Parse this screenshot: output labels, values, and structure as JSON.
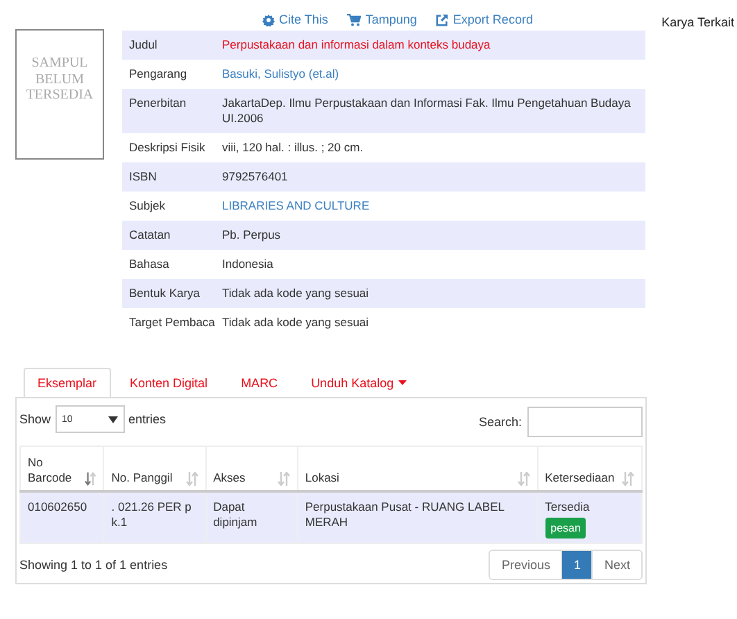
{
  "cover": {
    "text": "SAMPUL BELUM TERSEDIA"
  },
  "actions": [
    {
      "label": "Cite This"
    },
    {
      "label": "Tampung"
    },
    {
      "label": "Export Record"
    }
  ],
  "related": {
    "title": "Karya Terkait"
  },
  "details": [
    {
      "label": "Judul",
      "value": "Perpustakaan dan informasi dalam konteks budaya",
      "kind": "title"
    },
    {
      "label": "Pengarang",
      "value": "Basuki, Sulistyo (et.al)",
      "kind": "link"
    },
    {
      "label": "Penerbitan",
      "value": "JakartaDep. Ilmu Perpustakaan dan Informasi Fak. Ilmu Pengetahuan Budaya UI.2006",
      "kind": "text"
    },
    {
      "label": "Deskripsi Fisik",
      "value": "viii, 120 hal. : illus. ; 20 cm.",
      "kind": "text"
    },
    {
      "label": "ISBN",
      "value": "9792576401",
      "kind": "text"
    },
    {
      "label": "Subjek",
      "value": "LIBRARIES AND CULTURE",
      "kind": "link"
    },
    {
      "label": "Catatan",
      "value": "Pb. Perpus",
      "kind": "text"
    },
    {
      "label": "Bahasa",
      "value": "Indonesia",
      "kind": "text"
    },
    {
      "label": "Bentuk Karya",
      "value": "Tidak ada kode yang sesuai",
      "kind": "text"
    },
    {
      "label": "Target Pembaca",
      "value": "Tidak ada kode yang sesuai",
      "kind": "text"
    }
  ],
  "tabs": [
    {
      "label": "Eksemplar",
      "selected": true,
      "dropdown": false
    },
    {
      "label": "Konten Digital",
      "selected": false,
      "dropdown": false
    },
    {
      "label": "MARC",
      "selected": false,
      "dropdown": false
    },
    {
      "label": "Unduh Katalog",
      "selected": false,
      "dropdown": true
    }
  ],
  "length": {
    "prefix": "Show",
    "value": "10",
    "suffix": "entries"
  },
  "search": {
    "label": "Search:"
  },
  "table": {
    "columns": [
      {
        "label": "No Barcode",
        "sorted": true
      },
      {
        "label": "No. Panggil",
        "sorted": false
      },
      {
        "label": "Akses",
        "sorted": false
      },
      {
        "label": "Lokasi",
        "sorted": false
      },
      {
        "label": "Ketersediaan",
        "sorted": false
      }
    ],
    "rows": [
      {
        "cells": [
          "010602650",
          ". 021.26 PER p k.1",
          "Dapat dipinjam",
          "Perpustakaan Pusat - RUANG LABEL MERAH",
          "Tersedia"
        ],
        "badge": "pesan"
      }
    ]
  },
  "info": "Showing 1 to 1 of 1 entries",
  "pagination": [
    {
      "label": "Previous",
      "selected": false
    },
    {
      "label": "1",
      "selected": true
    },
    {
      "label": "Next",
      "selected": false
    }
  ]
}
